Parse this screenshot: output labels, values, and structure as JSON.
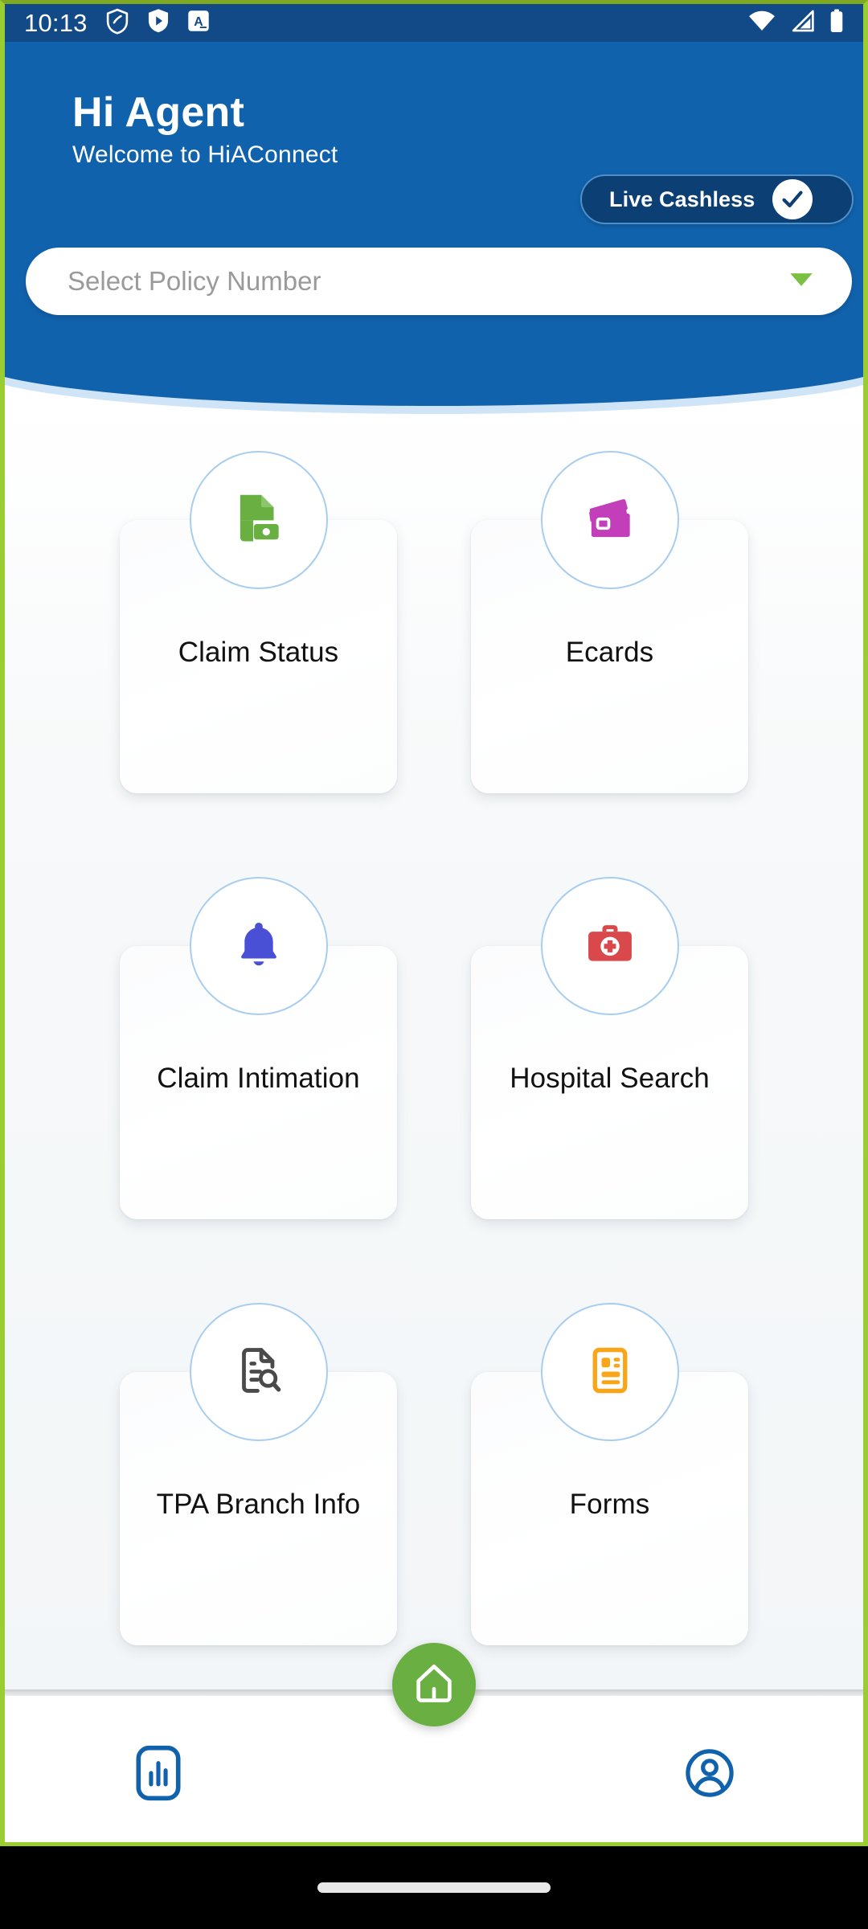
{
  "status_bar": {
    "time": "10:13",
    "left_icons": [
      "shield-icon",
      "play-shield-icon",
      "app-badge-a-icon"
    ],
    "right_icons": [
      "wifi-icon",
      "cellular-signal-icon",
      "battery-icon"
    ]
  },
  "header": {
    "greeting": "Hi Agent",
    "subtitle": "Welcome to HiAConnect",
    "brand_blue": "#1162ad",
    "status_blue": "#124a87",
    "live_cashless": {
      "label": "Live Cashless",
      "pill_color": "#0c3f73",
      "check_icon": "check-circle-icon"
    }
  },
  "policy_select": {
    "placeholder": "Select Policy Number",
    "value": "",
    "caret_icon": "chevron-down-icon",
    "caret_color": "#7ac143"
  },
  "menu": {
    "tiles": [
      {
        "label": "Claim Status",
        "icon": "document-money-icon",
        "color": "#6aaf41"
      },
      {
        "label": "Ecards",
        "icon": "cards-stack-icon",
        "color": "#c33fba"
      },
      {
        "label": "Claim Intimation",
        "icon": "bell-icon",
        "color": "#4a50d6"
      },
      {
        "label": "Hospital Search",
        "icon": "medical-briefcase-icon",
        "color": "#d9484b"
      },
      {
        "label": "TPA Branch Info",
        "icon": "document-search-icon",
        "color": "#4a4a4a"
      },
      {
        "label": "Forms",
        "icon": "form-document-icon",
        "color": "#f9a51a"
      }
    ]
  },
  "bottom_nav": {
    "items": [
      {
        "name": "reports",
        "icon": "bar-chart-icon",
        "color": "#1162ad"
      },
      {
        "name": "home",
        "icon": "home-icon",
        "color": "#6aaf41"
      },
      {
        "name": "profile",
        "icon": "user-circle-icon",
        "color": "#1162ad"
      }
    ]
  },
  "system": {
    "gesture_handle": "gesture-pill"
  }
}
